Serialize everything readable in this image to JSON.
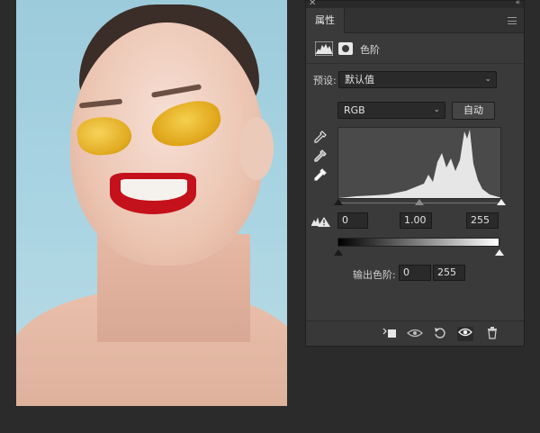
{
  "panel": {
    "tab_label": "属性",
    "adjustment_title": "色阶",
    "preset": {
      "label": "预设:",
      "value": "默认值"
    },
    "channel": {
      "value": "RGB"
    },
    "auto_button": "自动",
    "input_levels": {
      "black": "0",
      "gamma": "1.00",
      "white": "255"
    },
    "output_levels": {
      "label": "输出色阶:",
      "black": "0",
      "white": "255"
    }
  },
  "icons": {
    "close": "close-icon",
    "collapse": "collapse-icon",
    "panel_menu": "panel-menu-icon",
    "levels": "levels-icon",
    "mask": "mask-icon",
    "black_eyedropper": "eyedropper-black-icon",
    "gray_eyedropper": "eyedropper-gray-icon",
    "white_eyedropper": "eyedropper-white-icon",
    "clipping_warning": "clipping-warning-icon",
    "clip_to_layer": "clip-to-layer-icon",
    "view_previous": "view-previous-icon",
    "reset": "reset-icon",
    "visibility": "eye-icon",
    "delete": "trash-icon"
  },
  "colors": {
    "panel_bg": "#3a3a3a",
    "app_bg": "#2b2b2b",
    "histogram_fill": "#e6e6e6"
  }
}
